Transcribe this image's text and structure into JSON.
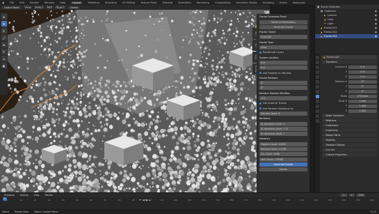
{
  "menubar": {
    "menus": [
      "File",
      "Edit",
      "Render",
      "Window",
      "Help"
    ],
    "tabs": [
      "Layout",
      "Modeling",
      "Sculpting",
      "UV Editing",
      "Texture Paint",
      "Shading",
      "Animation",
      "Rendering",
      "Compositing",
      "Geometry Nodes",
      "Scripting"
    ],
    "active_tab": "Layout",
    "scene": "Scene",
    "view_layer": "ViewLayer"
  },
  "viewport_header": {
    "mode": "Object Mode",
    "menus": [
      "View",
      "Select",
      "Add",
      "Object"
    ],
    "orientation": "Global"
  },
  "tools": [
    "cursor-icon",
    "move-icon",
    "rotate-icon",
    "scale-icon",
    "transform-icon",
    "annotate-icon",
    "measure-icon",
    "add-cube-icon"
  ],
  "npanel": {
    "tabs": [
      "Item",
      "Tool",
      "View",
      "Fractal"
    ],
    "title": "Fractal Generator Panel",
    "rows": [
      {
        "kind": "btn",
        "text": "Reset All Parameters"
      },
      {
        "kind": "btn",
        "text": "Generate Fractal"
      },
      {
        "kind": "head",
        "text": "Fractal Object:"
      },
      {
        "kind": "field",
        "text": "Cube.001"
      },
      {
        "kind": "head",
        "text": "Fractal Type:"
      },
      {
        "kind": "field",
        "text": "Cube"
      },
      {
        "kind": "check",
        "text": "Randomize Layers"
      },
      {
        "kind": "head",
        "text": "System Location:"
      },
      {
        "kind": "field",
        "text": "0 m"
      },
      {
        "kind": "field",
        "text": "0 m"
      },
      {
        "kind": "check",
        "text": "Add Rotation to 360 deg"
      },
      {
        "kind": "head",
        "text": "Fractal Rotation:"
      },
      {
        "kind": "field",
        "text": "0°"
      },
      {
        "kind": "field",
        "text": "0°"
      },
      {
        "kind": "head",
        "text": "Random Rotation Min/Max:"
      },
      {
        "kind": "field",
        "text": "-0.1"
      },
      {
        "kind": "check",
        "text": "Use Scale for Fractal"
      },
      {
        "kind": "check",
        "text": "Use Random Variations for"
      },
      {
        "kind": "field",
        "text": "Random Seed: 6"
      },
      {
        "kind": "head",
        "text": "Iterations"
      },
      {
        "kind": "field",
        "text": "Nr Iterations Level: 3"
      },
      {
        "kind": "field",
        "text": "Nr Iterations Level: 1.21"
      },
      {
        "kind": "field",
        "text": "Nr Iterations Level: 7"
      },
      {
        "kind": "head",
        "text": "Statistics"
      },
      {
        "kind": "field",
        "text": "Objects Count: 10630"
      },
      {
        "kind": "field",
        "text": "Memory Used: 2.2 MB"
      },
      {
        "kind": "field",
        "text": "Tris Count: 5096"
      },
      {
        "kind": "field",
        "text": "Vert Count: 178580"
      },
      {
        "kind": "blue",
        "text": "Generate Fractal"
      },
      {
        "kind": "btn",
        "text": "Delete"
      }
    ]
  },
  "outliner": {
    "title": "Scene Collection",
    "items": [
      {
        "label": "Collection",
        "icon": "collection-icon",
        "selected": false,
        "indent": 1
      },
      {
        "label": "Camera",
        "icon": "camera-icon",
        "selected": false,
        "indent": 2
      },
      {
        "label": "Cube",
        "icon": "mesh-icon",
        "selected": false,
        "indent": 2
      },
      {
        "label": "Light",
        "icon": "light-icon",
        "selected": false,
        "indent": 2
      },
      {
        "label": "Fractal.001",
        "icon": "mesh-icon",
        "selected": false,
        "indent": 1
      },
      {
        "label": "Fractal.002",
        "icon": "mesh-icon",
        "selected": false,
        "indent": 1
      },
      {
        "label": "Fractal.003",
        "icon": "mesh-icon",
        "selected": true,
        "indent": 1
      }
    ]
  },
  "properties": {
    "object_name": "Fractal.003",
    "rows": [
      {
        "kind": "sec",
        "label": "Transform"
      },
      {
        "kind": "field",
        "label": "Location X",
        "value": "0 m"
      },
      {
        "kind": "field",
        "label": "Y",
        "value": "0 m"
      },
      {
        "kind": "field",
        "label": "Z",
        "value": "0 m"
      },
      {
        "kind": "field",
        "label": "Rotation X",
        "value": "0°"
      },
      {
        "kind": "field",
        "label": "Y",
        "value": "0°"
      },
      {
        "kind": "field",
        "label": "Z",
        "value": "0°"
      },
      {
        "kind": "field",
        "label": "Mode",
        "value": "XYZ Euler"
      },
      {
        "kind": "field",
        "label": "Scale X",
        "value": "1.000"
      },
      {
        "kind": "field",
        "label": "Y",
        "value": "1.000"
      },
      {
        "kind": "field",
        "label": "Z",
        "value": "1.000"
      },
      {
        "kind": "sec",
        "label": "Delta Transform"
      },
      {
        "kind": "sec",
        "label": "Relations"
      },
      {
        "kind": "sec",
        "label": "Collections"
      },
      {
        "kind": "sec",
        "label": "Instancing"
      },
      {
        "kind": "sec",
        "label": "Motion Paths"
      },
      {
        "kind": "sec",
        "label": "Visibility"
      },
      {
        "kind": "sec",
        "label": "Viewport Display"
      },
      {
        "kind": "sec",
        "label": "Line Art"
      },
      {
        "kind": "sec",
        "label": "Custom Properties"
      }
    ]
  },
  "timeline": {
    "menus": [
      "Playback",
      "Keying",
      "View",
      "Marker"
    ],
    "current_frame": "1",
    "start": "1",
    "end": "250",
    "ruler": [
      "0",
      "10",
      "20",
      "30",
      "40",
      "50",
      "60",
      "70",
      "80",
      "90",
      "100",
      "110",
      "120",
      "130",
      "140",
      "150",
      "160",
      "170",
      "180",
      "190",
      "200",
      "210",
      "220",
      "230",
      "240",
      "250",
      "260"
    ]
  },
  "statusbar": {
    "items": [
      "Select",
      "Rotate View",
      "Object Context Menu"
    ],
    "version": "3.1.0"
  },
  "colors": {
    "accent": "#4772b3",
    "selection_outline": "#e08a2a",
    "geometry_light": "#cfcfcf",
    "geometry_shadow": "#6e6e6e",
    "background_dark": "#2a1f15"
  }
}
